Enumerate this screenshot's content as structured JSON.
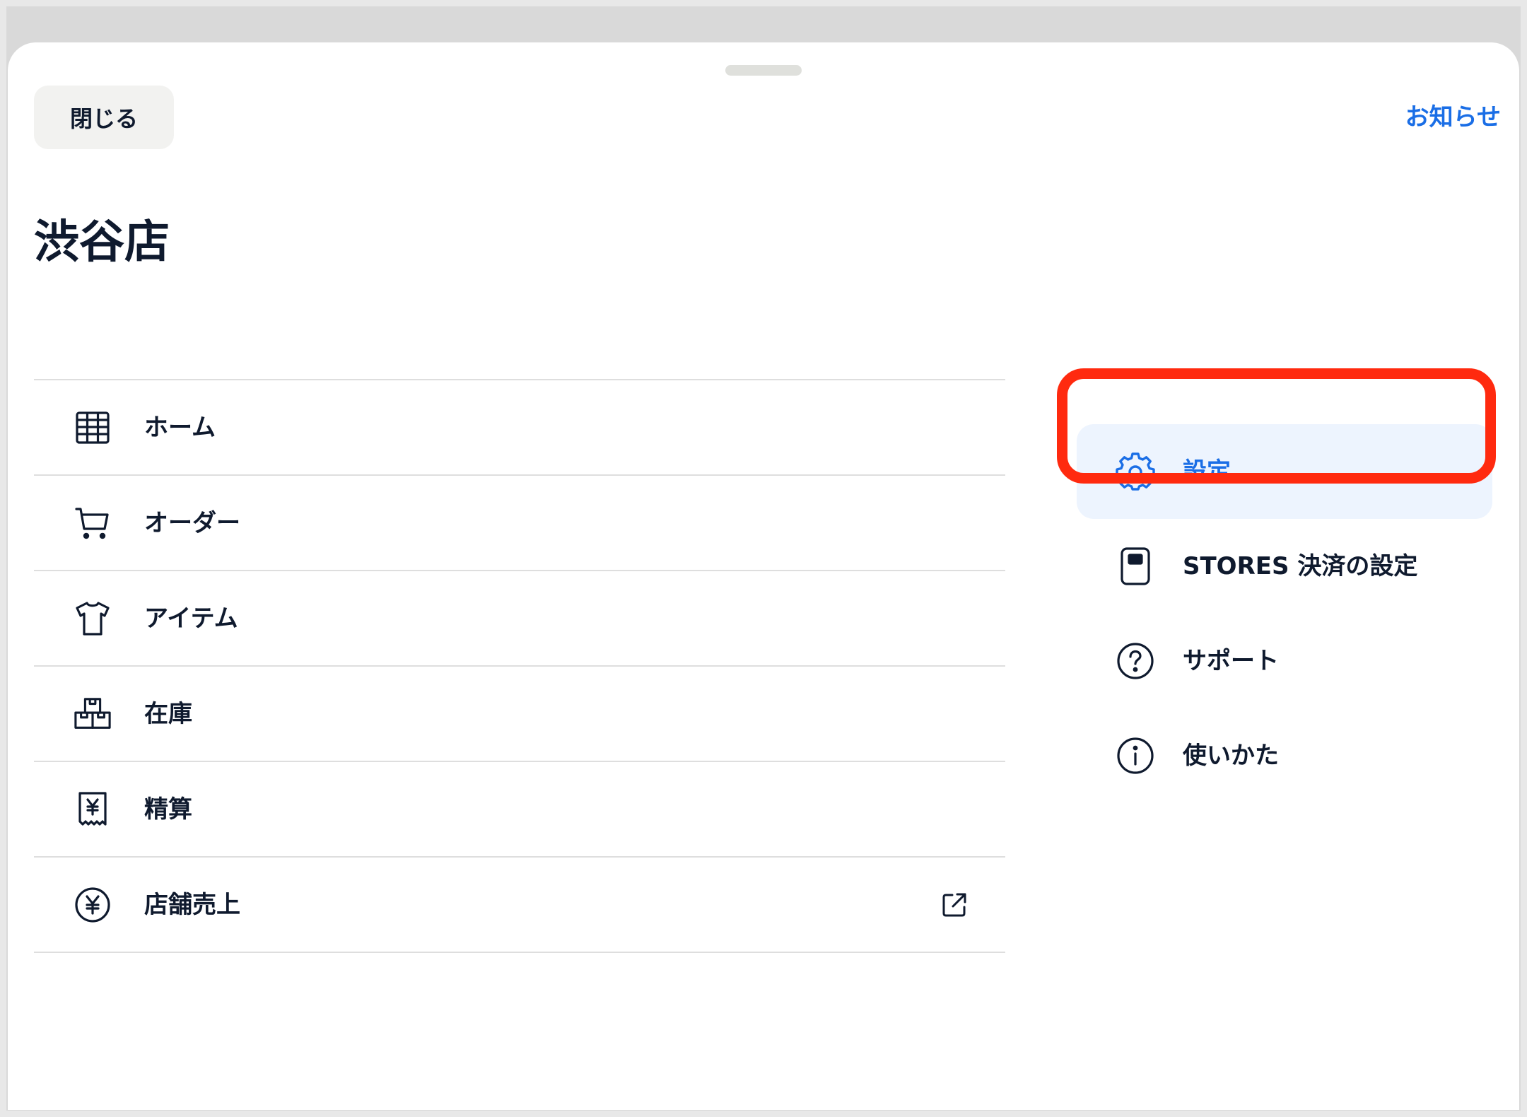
{
  "header": {
    "close_label": "閉じる",
    "news_label": "お知らせ"
  },
  "store": {
    "title": "渋谷店"
  },
  "main_menu": {
    "items": [
      {
        "label": "ホーム",
        "icon": "grid-icon"
      },
      {
        "label": "オーダー",
        "icon": "cart-icon"
      },
      {
        "label": "アイテム",
        "icon": "shirt-icon"
      },
      {
        "label": "在庫",
        "icon": "boxes-icon"
      },
      {
        "label": "精算",
        "icon": "yen-receipt-icon"
      },
      {
        "label": "店舗売上",
        "icon": "yen-circle-icon",
        "external": true
      }
    ]
  },
  "side_menu": {
    "items": [
      {
        "label": "設定",
        "icon": "gear-icon",
        "active": true
      },
      {
        "label": "STORES 決済の設定",
        "icon": "card-reader-icon"
      },
      {
        "label": "サポート",
        "icon": "question-circle-icon"
      },
      {
        "label": "使いかた",
        "icon": "info-circle-icon"
      }
    ]
  },
  "colors": {
    "accent": "#1a6ee6",
    "text": "#0f1a2e",
    "highlight": "#ff2a0f",
    "active_bg": "#edf4fe"
  }
}
